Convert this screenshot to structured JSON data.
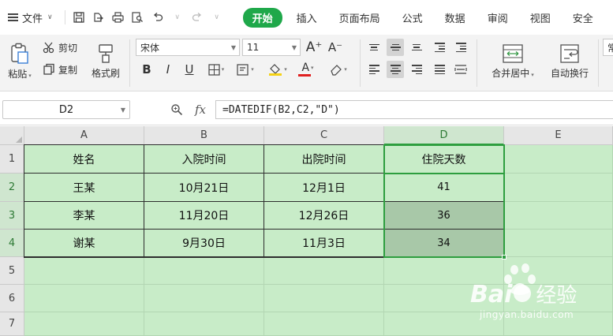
{
  "menubar": {
    "file_label": "文件",
    "tabs": [
      "开始",
      "插入",
      "页面布局",
      "公式",
      "数据",
      "审阅",
      "视图",
      "安全"
    ],
    "active_tab": "开始"
  },
  "ribbon": {
    "paste": "粘贴",
    "cut": "剪切",
    "copy": "复制",
    "format_painter": "格式刷",
    "font_name": "宋体",
    "font_size": "11",
    "merge_center": "合并居中",
    "wrap_text": "自动换行",
    "bold": "B",
    "italic": "I",
    "underline": "U",
    "font_color_glyph": "A",
    "grow_font": "A⁺",
    "shrink_font": "A⁻",
    "right_edge_text": "常"
  },
  "formula_bar": {
    "name_box": "D2",
    "fx_label": "fx",
    "formula": "=DATEDIF(B2,C2,\"D\")"
  },
  "sheet": {
    "columns": [
      "A",
      "B",
      "C",
      "D",
      "E"
    ],
    "rows": [
      "1",
      "2",
      "3",
      "4",
      "5",
      "6",
      "7"
    ],
    "selected_column": "D",
    "selection": "D2:D4",
    "data": [
      [
        "姓名",
        "入院时间",
        "出院时间",
        "住院天数"
      ],
      [
        "王某",
        "10月21日",
        "12月1日",
        "41"
      ],
      [
        "李某",
        "11月20日",
        "12月26日",
        "36"
      ],
      [
        "谢某",
        "9月30日",
        "11月3日",
        "34"
      ]
    ],
    "cell_fill": "#c8ecc8",
    "selection_color": "#2e9e3f"
  },
  "watermark": {
    "brand": "Bai",
    "brand2": "经验",
    "url": "jingyan.baidu.com"
  }
}
